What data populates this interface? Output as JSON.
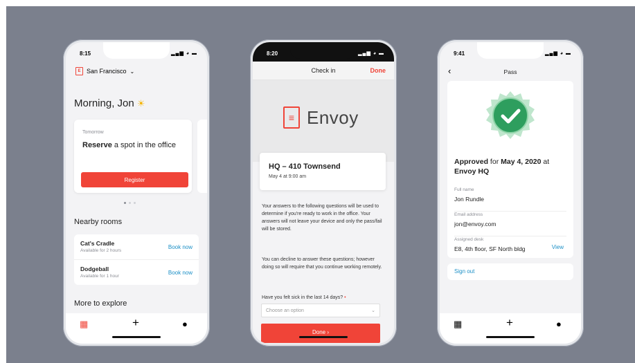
{
  "colors": {
    "accent": "#f04438",
    "link": "#1b8fc6",
    "backdrop": "#7b808d",
    "success": "#2e9e5e"
  },
  "phone1": {
    "time": "8:15",
    "status_icons": "▂▄▆ ◕ ▬",
    "city": "San Francisco",
    "greeting": "Morning, Jon",
    "card": {
      "when": "Tomorrow",
      "action_bold": "Reserve",
      "action_rest": " a spot in the office",
      "button": "Register"
    },
    "nearby_title": "Nearby rooms",
    "rooms": [
      {
        "name": "Cat's Cradle",
        "availability": "Available for 2 hours",
        "action": "Book now"
      },
      {
        "name": "Dodgeball",
        "availability": "Available for 1 hour",
        "action": "Book now"
      }
    ],
    "explore_title": "More to explore",
    "tabs": [
      "building-icon",
      "plus-icon",
      "person-icon"
    ]
  },
  "phone2": {
    "time": "8:20",
    "status_icons": "▂▄▆ ◕ ▬",
    "title": "Check in",
    "done_link": "Done",
    "brand": "Envoy",
    "location": "HQ – 410 Townsend",
    "date": "May 4 at 9:00 am",
    "para1": "Your answers to the following questions will be used to determine if you're ready to work in the office. Your answers will not leave your device and only the pass/fail will be stored.",
    "para2": "You can decline to answer these questions; however doing so will require that you continue working remotely.",
    "question": "Have you felt sick in the last 14 days?",
    "required_mark": "•",
    "select_placeholder": "Choose an option",
    "done_button": "Done ›"
  },
  "phone3": {
    "time": "9:41",
    "status_icons": "▂▄▆ ◕ ▬",
    "back": "‹",
    "title": "Pass",
    "approved_bold": "Approved",
    "approved_for": " for ",
    "approved_date": "May 4, 2020",
    "approved_at": " at ",
    "approved_place": "Envoy HQ",
    "fields": [
      {
        "label": "Full name",
        "value": "Jon Rundle"
      },
      {
        "label": "Email address",
        "value": "jon@envoy.com"
      },
      {
        "label": "Assigned desk",
        "value": "E8, 4th floor, SF North bldg",
        "action": "View"
      }
    ],
    "sign_out": "Sign out"
  }
}
